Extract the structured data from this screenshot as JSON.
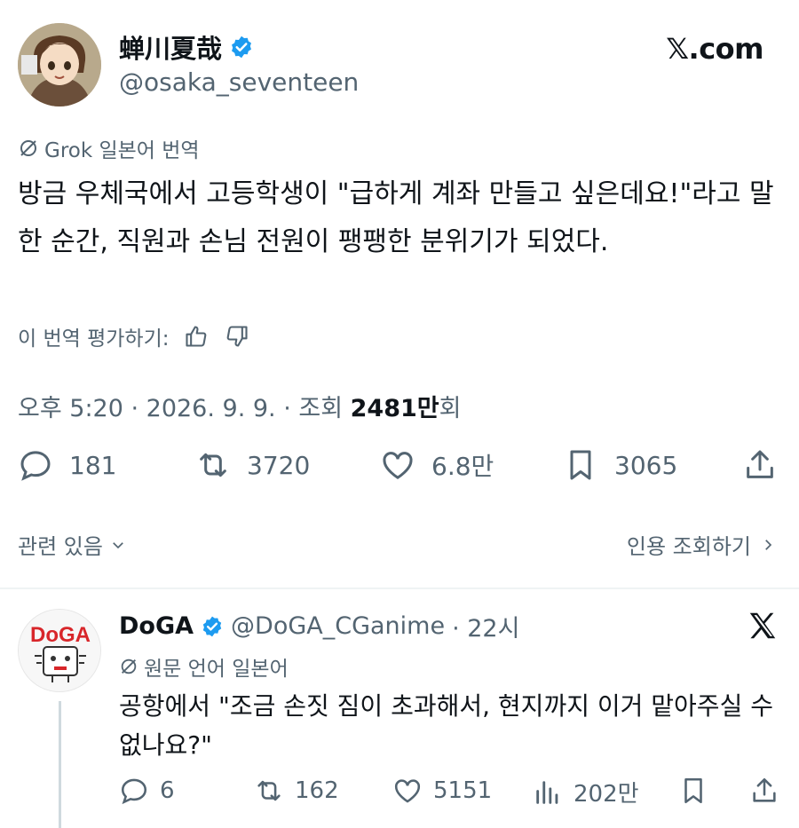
{
  "author": {
    "name": "蝉川夏哉",
    "handle": "@osaka_seventeen",
    "verified": true
  },
  "site_label": "𝕏.com",
  "translation": {
    "badge": "Grok 일본어 번역",
    "rate_label": "이 번역 평가하기:"
  },
  "tweet": {
    "text": "방금 우체국에서 고등학생이 \"급하게 계좌 만들고 싶은데요!\"라고 말한 순간, 직원과 손님 전원이 팽팽한 분위기가 되었다."
  },
  "meta": {
    "time_date": "오후 5:20 · 2026. 9. 9. · 조회 ",
    "views": "2481만",
    "views_suffix": "회"
  },
  "actions": {
    "replies": "181",
    "reposts": "3720",
    "likes": "6.8만",
    "bookmarks": "3065"
  },
  "related": {
    "label": "관련 있음",
    "quotes_label": "인용 조회하기"
  },
  "reply": {
    "name": "DoGA",
    "handle": "@DoGA_CGanime",
    "time": "· 22시",
    "lang_badge": "원문 언어 일본어",
    "text": "공항에서 \"조금 손짓 짐이 초과해서, 현지까지 이거 맡아주실 수 없나요?\"",
    "avatar_logo": "DoGA",
    "actions": {
      "replies": "6",
      "reposts": "162",
      "likes": "5151",
      "views": "202만"
    }
  },
  "colors": {
    "text": "#0f1419",
    "secondary": "#536471",
    "verified": "#1d9bf0",
    "divider": "#eff3f4"
  }
}
